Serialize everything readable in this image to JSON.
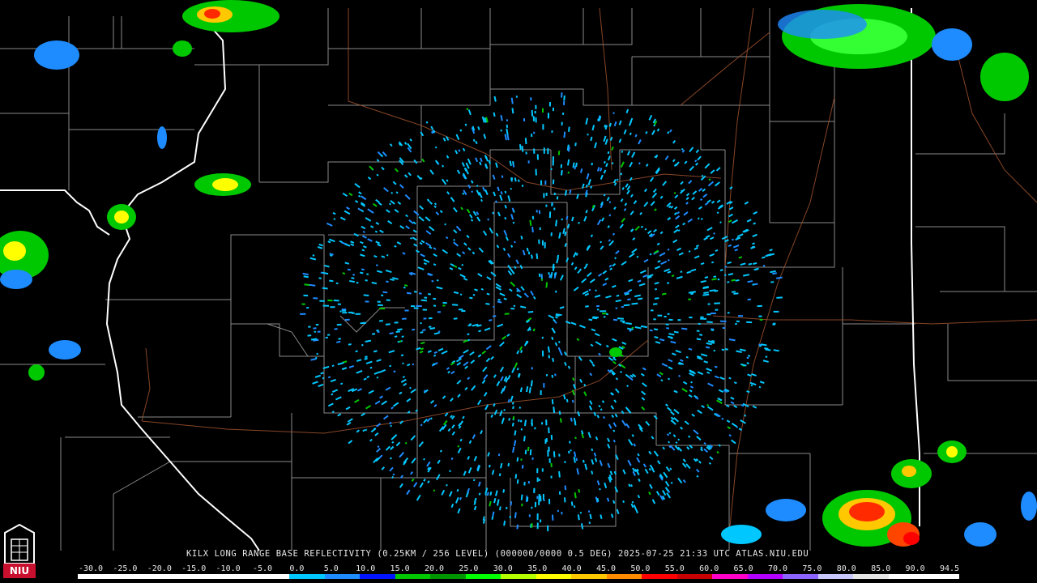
{
  "radar": {
    "product_caption": "KILX LONG RANGE BASE REFLECTIVITY (0.25KM / 256 LEVEL) (000000/0000 0.5 DEG) 2025-07-25 21:33 UTC  ATLAS.NIU.EDU",
    "scale_labels": [
      "-30.0",
      "-25.0",
      "-20.0",
      "-15.0",
      "-10.0",
      "-5.0",
      "0.0",
      "5.0",
      "10.0",
      "15.0",
      "20.0",
      "25.0",
      "30.0",
      "35.0",
      "40.0",
      "45.0",
      "50.0",
      "55.0",
      "60.0",
      "65.0",
      "70.0",
      "75.0",
      "80.0",
      "85.0",
      "90.0",
      "94.5"
    ],
    "scale_colors": [
      "#ffffff",
      "#ffffff",
      "#ffffff",
      "#ffffff",
      "#ffffff",
      "#ffffff",
      "#00c8ff",
      "#1e8cff",
      "#0014ff",
      "#00c800",
      "#009600",
      "#00ff00",
      "#b4ff00",
      "#ffff00",
      "#ffc800",
      "#ff8c00",
      "#ff0000",
      "#c80000",
      "#ff00c8",
      "#b400ff",
      "#8c64ff",
      "#c8c8ff",
      "#e6e6e6",
      "#ffffff",
      "#ffffff"
    ],
    "logo_text": "NIU"
  }
}
